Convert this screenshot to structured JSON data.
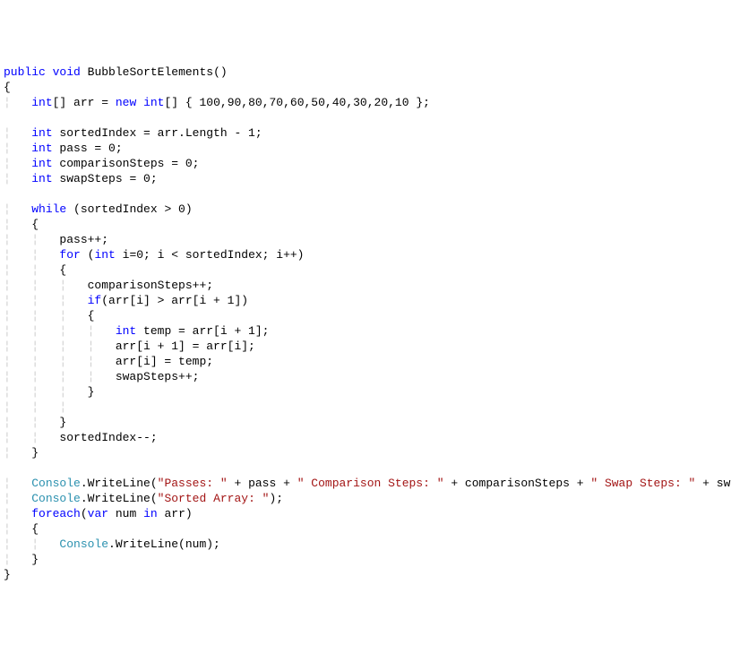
{
  "code": {
    "l01_public": "public",
    "l01_void": "void",
    "l01_method": "BubbleSortElements",
    "l01_paren": "()",
    "l02_brace": "{",
    "l03_int": "int",
    "l03_brackets": "[]",
    "l03_arr": "arr",
    "l03_eq": " = ",
    "l03_new": "new",
    "l03_int2": "int",
    "l03_arrinit": "[] { 100,90,80,70,60,50,40,30,20,10 };",
    "l05_int": "int",
    "l05_rest": " sortedIndex = arr.Length - 1;",
    "l06_int": "int",
    "l06_rest": " pass = 0;",
    "l07_int": "int",
    "l07_rest": " comparisonSteps = 0;",
    "l08_int": "int",
    "l08_rest": " swapSteps = 0;",
    "l10_while": "while",
    "l10_cond": " (sortedIndex > 0)",
    "l11_brace": "{",
    "l12": "pass++;",
    "l13_for": "for",
    "l13_open": " (",
    "l13_int": "int",
    "l13_rest": " i=0; i < sortedIndex; i++)",
    "l14_brace": "{",
    "l15": "comparisonSteps++;",
    "l16_if": "if",
    "l16_cond": "(arr[i] > arr[i + 1])",
    "l17_brace": "{",
    "l18_int": "int",
    "l18_rest": " temp = arr[i + 1];",
    "l19": "arr[i + 1] = arr[i];",
    "l20": "arr[i] = temp;",
    "l21": "swapSteps++;",
    "l22_brace": "}",
    "l24_brace": "}",
    "l25": "sortedIndex--;",
    "l26_brace": "}",
    "l28_console": "Console",
    "l28_wl": ".WriteLine(",
    "l28_s1": "\"Passes: \"",
    "l28_p1": " + pass + ",
    "l28_s2": "\" Comparison Steps: \"",
    "l28_p2": " + comparisonSteps + ",
    "l28_s3": "\" Swap Steps: \"",
    "l28_p3": " + swapSteps);",
    "l29_console": "Console",
    "l29_wl": ".WriteLine(",
    "l29_s1": "\"Sorted Array: \"",
    "l29_end": ");",
    "l30_foreach": "foreach",
    "l30_open": "(",
    "l30_var": "var",
    "l30_num": " num ",
    "l30_in": "in",
    "l30_rest": " arr)",
    "l31_brace": "{",
    "l32_console": "Console",
    "l32_rest": ".WriteLine(num);",
    "l33_brace": "}",
    "l34_brace": "}"
  }
}
